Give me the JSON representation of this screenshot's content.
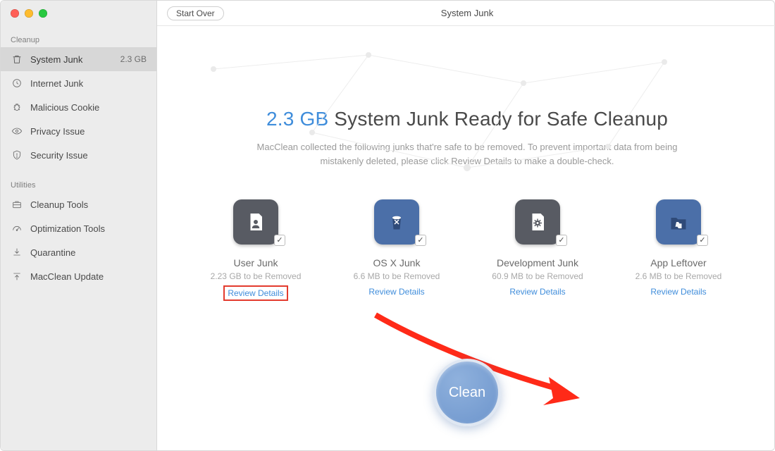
{
  "window": {
    "title": "System Junk"
  },
  "toolbar": {
    "start_over": "Start Over"
  },
  "sidebar": {
    "sections": [
      {
        "header": "Cleanup",
        "items": [
          {
            "label": "System Junk",
            "badge": "2.3 GB",
            "icon": "trash-icon",
            "active": true
          },
          {
            "label": "Internet Junk",
            "icon": "clock-icon"
          },
          {
            "label": "Malicious Cookie",
            "icon": "bug-icon"
          },
          {
            "label": "Privacy Issue",
            "icon": "eye-icon"
          },
          {
            "label": "Security Issue",
            "icon": "shield-icon"
          }
        ]
      },
      {
        "header": "Utilities",
        "items": [
          {
            "label": "Cleanup Tools",
            "icon": "briefcase-icon"
          },
          {
            "label": "Optimization Tools",
            "icon": "gauge-icon"
          },
          {
            "label": "Quarantine",
            "icon": "download-icon"
          },
          {
            "label": "MacClean Update",
            "icon": "upload-icon"
          }
        ]
      }
    ]
  },
  "headline": {
    "size": "2.3 GB",
    "rest": " System Junk Ready for Safe Cleanup"
  },
  "subhead": "MacClean collected the following junks that're safe to be removed. To prevent important data from being mistakenly deleted, please click Review Details to make a double-check.",
  "categories": [
    {
      "name": "User Junk",
      "sub": "2.23 GB to be Removed",
      "review": "Review Details",
      "icon": "user-doc",
      "highlight_review": true
    },
    {
      "name": "OS X Junk",
      "sub": "6.6 MB to be Removed",
      "review": "Review Details",
      "icon": "trash-round"
    },
    {
      "name": "Development Junk",
      "sub": "60.9 MB to be Removed",
      "review": "Review Details",
      "icon": "gear-doc"
    },
    {
      "name": "App Leftover",
      "sub": "2.6 MB to be Removed",
      "review": "Review Details",
      "icon": "folder-app"
    }
  ],
  "clean_button": "Clean"
}
